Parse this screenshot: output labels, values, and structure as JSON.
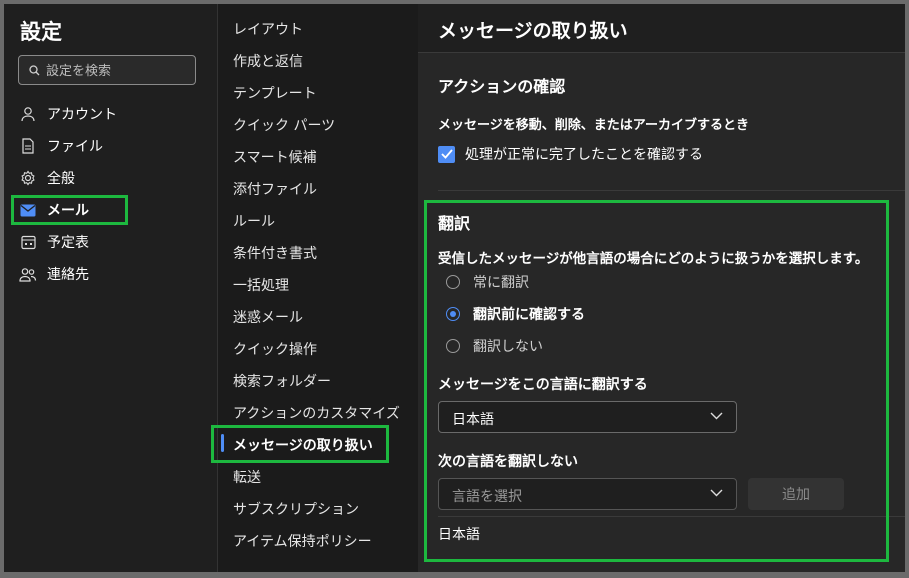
{
  "left": {
    "title": "設定",
    "search_placeholder": "設定を検索",
    "items": [
      {
        "label": "アカウント",
        "icon": "person-icon"
      },
      {
        "label": "ファイル",
        "icon": "file-icon"
      },
      {
        "label": "全般",
        "icon": "gear-icon"
      },
      {
        "label": "メール",
        "icon": "mail-icon",
        "active": true
      },
      {
        "label": "予定表",
        "icon": "calendar-icon"
      },
      {
        "label": "連絡先",
        "icon": "people-icon"
      }
    ]
  },
  "middle": {
    "items": [
      "レイアウト",
      "作成と返信",
      "テンプレート",
      "クイック パーツ",
      "スマート候補",
      "添付ファイル",
      "ルール",
      "条件付き書式",
      "一括処理",
      "迷惑メール",
      "クイック操作",
      "検索フォルダー",
      "アクションのカスタマイズ",
      "メッセージの取り扱い",
      "転送",
      "サブスクリプション",
      "アイテム保持ポリシー"
    ],
    "active_index": 13
  },
  "right": {
    "title": "メッセージの取り扱い",
    "confirm_section": {
      "heading": "アクションの確認",
      "label": "メッセージを移動、削除、またはアーカイブするとき",
      "checkbox_label": "処理が正常に完了したことを確認する",
      "checked": true
    },
    "translation": {
      "heading": "翻訳",
      "question": "受信したメッセージが他言語の場合にどのように扱うかを選択します。",
      "options": [
        "常に翻訳",
        "翻訳前に確認する",
        "翻訳しない"
      ],
      "selected_index": 1,
      "target_label": "メッセージをこの言語に翻訳する",
      "target_value": "日本語",
      "exclude_label": "次の言語を翻訳しない",
      "exclude_placeholder": "言語を選択",
      "add_button": "追加",
      "excluded_languages": [
        "日本語"
      ]
    }
  },
  "colors": {
    "accent": "#4f8df5",
    "highlight": "#1db83f",
    "background": "#1f1f1f"
  }
}
